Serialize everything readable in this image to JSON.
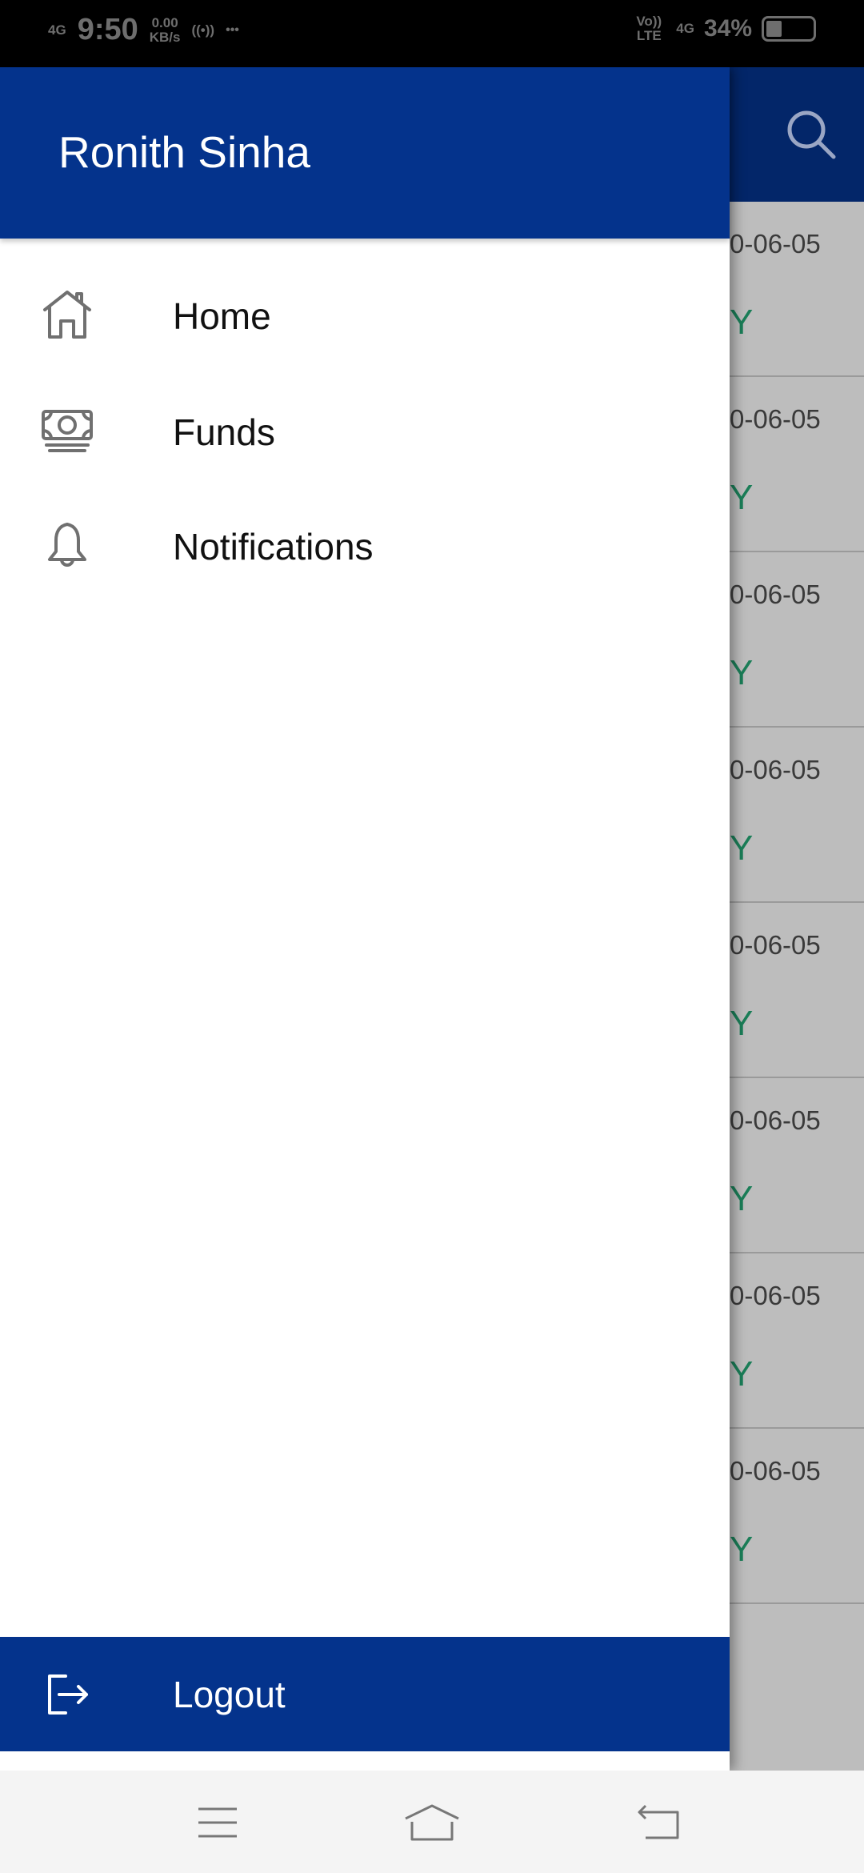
{
  "status_bar": {
    "network": "4G",
    "time": "9:50",
    "speed_value": "0.00",
    "speed_unit": "KB/s",
    "volte": "Vo)) LTE",
    "network_right": "4G",
    "battery": "34%",
    "battery_level": 0.34
  },
  "drawer": {
    "user_name": "Ronith Sinha",
    "items": [
      {
        "label": "Home",
        "icon": "home-icon"
      },
      {
        "label": "Funds",
        "icon": "money-icon"
      },
      {
        "label": "Notifications",
        "icon": "bell-icon"
      }
    ],
    "logout_label": "Logout"
  },
  "background_list": [
    {
      "date": "0-06-05",
      "flag": "Y"
    },
    {
      "date": "0-06-05",
      "flag": "Y"
    },
    {
      "date": "0-06-05",
      "flag": "Y"
    },
    {
      "date": "0-06-05",
      "flag": "Y"
    },
    {
      "date": "0-06-05",
      "flag": "Y"
    },
    {
      "date": "0-06-05",
      "flag": "Y"
    },
    {
      "date": "0-06-05",
      "flag": "Y"
    },
    {
      "date": "0-06-05",
      "flag": "Y"
    }
  ],
  "colors": {
    "primary": "#04338c",
    "flag": "#1b7e58"
  }
}
